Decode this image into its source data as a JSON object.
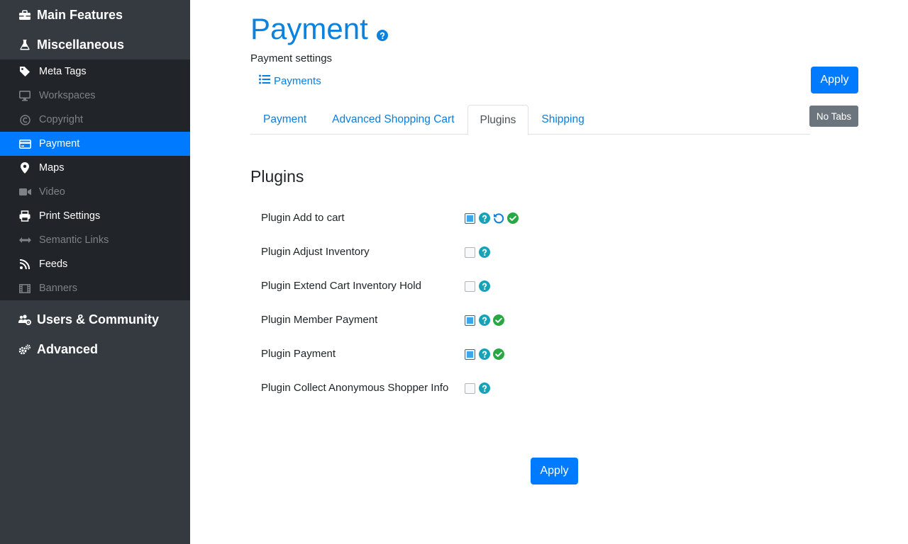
{
  "sidebar": {
    "top_categories": [
      {
        "label": "Main Features",
        "icon": "toolbox-icon"
      },
      {
        "label": "Miscellaneous",
        "icon": "flask-icon"
      }
    ],
    "sub_items": [
      {
        "label": "Meta Tags",
        "icon": "tag-icon",
        "state": "enabled"
      },
      {
        "label": "Workspaces",
        "icon": "desktop-icon",
        "state": "disabled"
      },
      {
        "label": "Copyright",
        "icon": "copyright-icon",
        "state": "disabled"
      },
      {
        "label": "Payment",
        "icon": "credit-card-icon",
        "state": "active"
      },
      {
        "label": "Maps",
        "icon": "map-marker-icon",
        "state": "enabled"
      },
      {
        "label": "Video",
        "icon": "video-icon",
        "state": "disabled"
      },
      {
        "label": "Print Settings",
        "icon": "print-icon",
        "state": "enabled"
      },
      {
        "label": "Semantic Links",
        "icon": "arrows-h-icon",
        "state": "disabled"
      },
      {
        "label": "Feeds",
        "icon": "rss-icon",
        "state": "enabled"
      },
      {
        "label": "Banners",
        "icon": "film-icon",
        "state": "disabled"
      }
    ],
    "bottom_categories": [
      {
        "label": "Users & Community",
        "icon": "users-cog-icon"
      },
      {
        "label": "Advanced",
        "icon": "cogs-icon"
      }
    ]
  },
  "main": {
    "title": "Payment",
    "subtitle": "Payment settings",
    "payments_link": "Payments",
    "apply_label": "Apply",
    "notabs_label": "No Tabs",
    "tabs": [
      {
        "label": "Payment",
        "active": false
      },
      {
        "label": "Advanced Shopping Cart",
        "active": false
      },
      {
        "label": "Plugins",
        "active": true
      },
      {
        "label": "Shipping",
        "active": false
      }
    ],
    "section_title": "Plugins",
    "plugins": [
      {
        "label": "Plugin Add to cart",
        "checked": true,
        "reset": true,
        "ok": true
      },
      {
        "label": "Plugin Adjust Inventory",
        "checked": false,
        "reset": false,
        "ok": false
      },
      {
        "label": "Plugin Extend Cart Inventory Hold",
        "checked": false,
        "reset": false,
        "ok": false
      },
      {
        "label": "Plugin Member Payment",
        "checked": true,
        "reset": false,
        "ok": true
      },
      {
        "label": "Plugin Payment",
        "checked": true,
        "reset": false,
        "ok": true
      },
      {
        "label": "Plugin Collect Anonymous Shopper Info",
        "checked": false,
        "reset": false,
        "ok": false
      }
    ],
    "colors": {
      "accent": "#007bff",
      "help": "#17a2b8",
      "ok": "#28a745",
      "sidebar_bg": "#343a40",
      "sidebar_sub_bg": "#212529"
    }
  }
}
